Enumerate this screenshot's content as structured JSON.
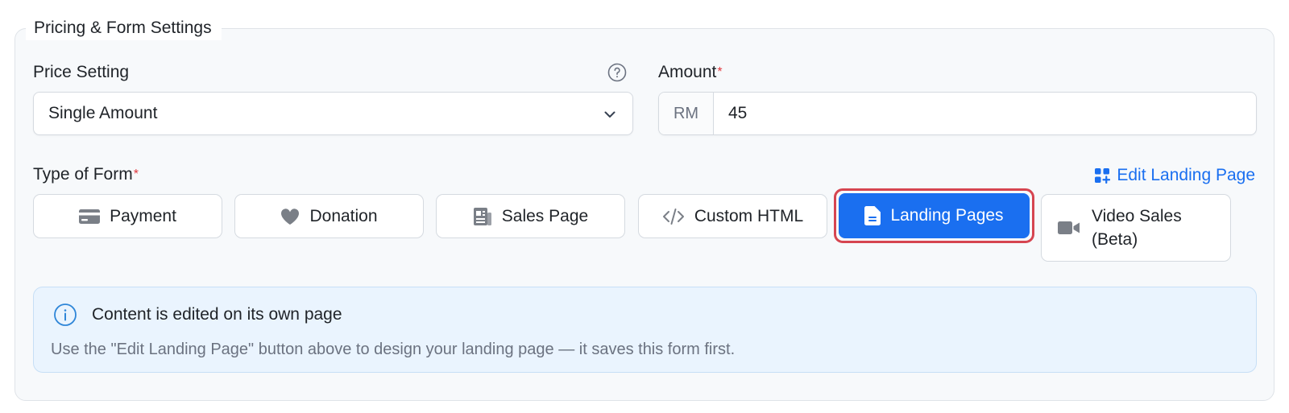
{
  "section": {
    "legend": "Pricing & Form Settings"
  },
  "price_setting": {
    "label": "Price Setting",
    "help_icon": "question-circle-icon",
    "selected": "Single Amount",
    "chevron_icon": "chevron-down-icon"
  },
  "amount": {
    "label": "Amount",
    "required_mark": "*",
    "currency_prefix": "RM",
    "value": "45"
  },
  "form_type": {
    "label": "Type of Form",
    "required_mark": "*",
    "edit_link": {
      "label": "Edit Landing Page",
      "icon": "apps-plus-icon"
    },
    "options": [
      {
        "label": "Payment",
        "icon": "credit-card-icon",
        "selected": false
      },
      {
        "label": "Donation",
        "icon": "heart-icon",
        "selected": false
      },
      {
        "label": "Sales Page",
        "icon": "newspaper-icon",
        "selected": false
      },
      {
        "label": "Custom HTML",
        "icon": "code-icon",
        "selected": false
      },
      {
        "label": "Landing Pages",
        "icon": "document-icon",
        "selected": true
      },
      {
        "label": "Video Sales (Beta)",
        "line1": "Video Sales",
        "line2": "(Beta)",
        "icon": "video-camera-icon",
        "selected": false
      }
    ]
  },
  "info_box": {
    "icon": "info-circle-icon",
    "title": "Content is edited on its own page",
    "body": "Use the \"Edit Landing Page\" button above to design your landing page — it saves this form first."
  },
  "colors": {
    "accent": "#1a6ff0",
    "highlight_border": "#d64550",
    "required": "#e0383e",
    "info_bg": "#eaf4fe"
  }
}
